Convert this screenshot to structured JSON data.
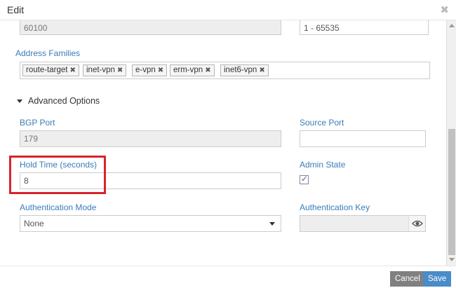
{
  "dialog": {
    "title": "Edit"
  },
  "top_row": {
    "asn_value": "60100",
    "range_value": "1 - 65535"
  },
  "address_families": {
    "label": "Address Families",
    "tags": [
      "route-target",
      "inet-vpn",
      "e-vpn",
      "erm-vpn",
      "inet6-vpn"
    ]
  },
  "advanced": {
    "label": "Advanced Options"
  },
  "bgp_port": {
    "label": "BGP Port",
    "value": "179"
  },
  "source_port": {
    "label": "Source Port",
    "value": ""
  },
  "hold_time": {
    "label": "Hold Time (seconds)",
    "value": "8"
  },
  "admin_state": {
    "label": "Admin State",
    "checked": true
  },
  "auth_mode": {
    "label": "Authentication Mode",
    "value": "None"
  },
  "auth_key": {
    "label": "Authentication Key",
    "value": ""
  },
  "footer": {
    "cancel": "Cancel",
    "save": "Save"
  },
  "colors": {
    "label": "#3a7cb8",
    "highlight": "#d9232d",
    "save": "#4a8bc9",
    "cancel": "#808080"
  },
  "icons": {
    "close": "close-icon",
    "caret": "caret-down-icon",
    "eye": "eye-icon",
    "check": "check-icon"
  }
}
